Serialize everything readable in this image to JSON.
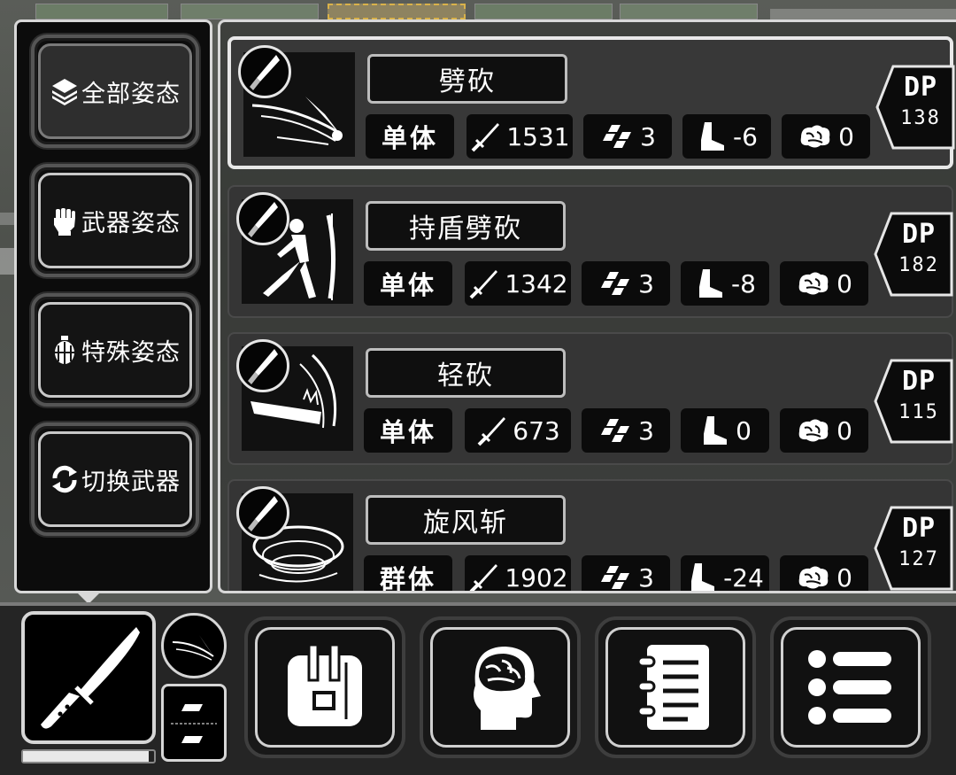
{
  "categories": [
    {
      "label": "全部姿态",
      "icon": "stack-layers-icon",
      "active": true
    },
    {
      "label": "武器姿态",
      "icon": "fist-icon",
      "active": false
    },
    {
      "label": "特殊姿态",
      "icon": "grenade-icon",
      "active": false
    },
    {
      "label": "切换武器",
      "icon": "swap-arrows-icon",
      "active": false
    }
  ],
  "skills": [
    {
      "name": "劈砍",
      "target": "单体",
      "damage": "1531",
      "cost": "3",
      "move": "-6",
      "mind": "0",
      "dp_label": "DP",
      "dp_value": "138",
      "selected": true
    },
    {
      "name": "持盾劈砍",
      "target": "单体",
      "damage": "1342",
      "cost": "3",
      "move": "-8",
      "mind": "0",
      "dp_label": "DP",
      "dp_value": "182",
      "selected": false
    },
    {
      "name": "轻砍",
      "target": "单体",
      "damage": "673",
      "cost": "3",
      "move": "0",
      "mind": "0",
      "dp_label": "DP",
      "dp_value": "115",
      "selected": false
    },
    {
      "name": "旋风斩",
      "target": "群体",
      "damage": "1902",
      "cost": "3",
      "move": "-24",
      "mind": "0",
      "dp_label": "DP",
      "dp_value": "127",
      "selected": false
    }
  ],
  "weapon": {
    "icon": "knife-icon",
    "durability": 0.96
  },
  "toolbar": [
    {
      "icon": "backpack-icon"
    },
    {
      "icon": "brain-head-icon"
    },
    {
      "icon": "notebook-icon"
    },
    {
      "icon": "menu-list-icon"
    }
  ],
  "colors": {
    "panel_bg": "#0c0c0c",
    "frame": "#d8d8d8",
    "card_bg": "#353535",
    "text": "#ffffff"
  }
}
